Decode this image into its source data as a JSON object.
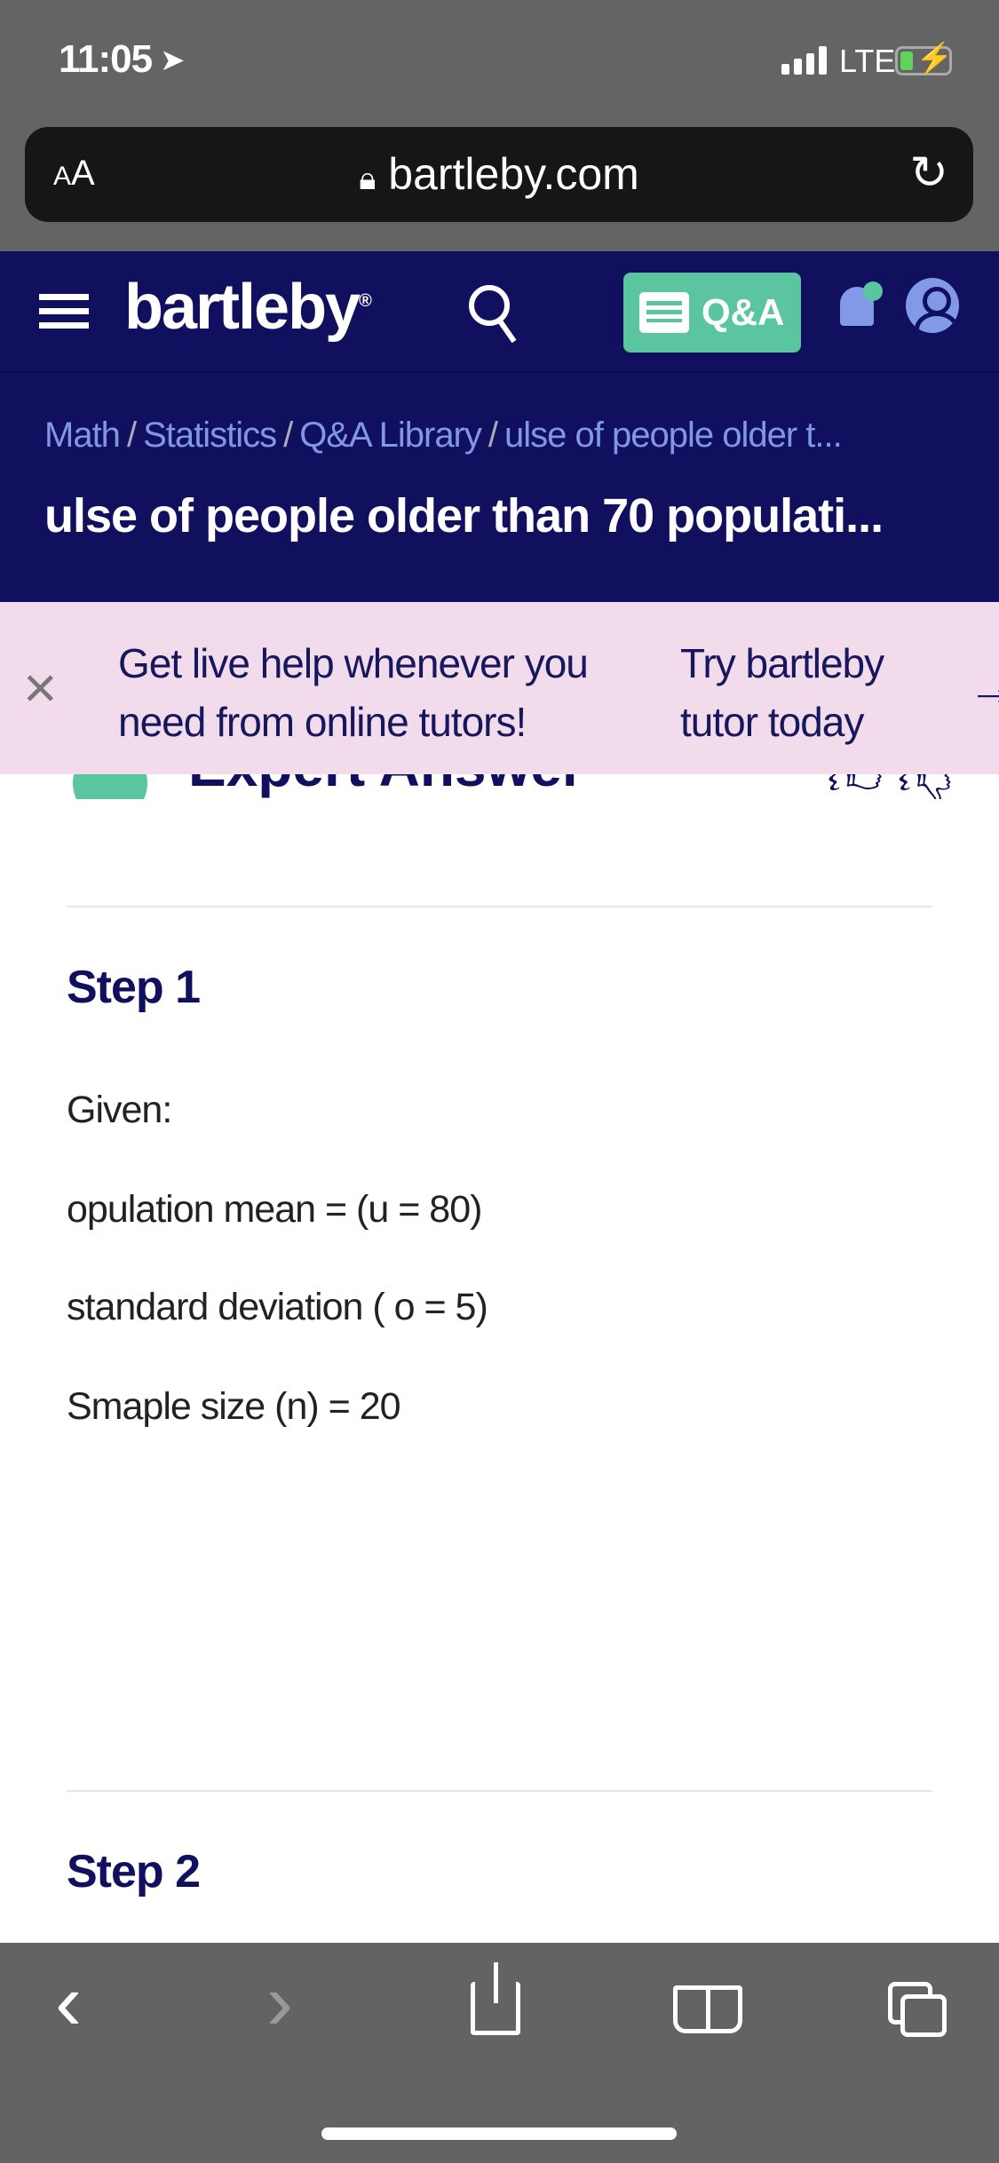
{
  "status_bar": {
    "time": "11:05",
    "location_icon": "location-arrow-icon",
    "network": "LTE",
    "battery_color": "#5fd35b"
  },
  "browser": {
    "text_size_label_small": "A",
    "text_size_label": "A",
    "url": "bartleby.com",
    "lock_icon": "lock-icon",
    "reload_icon": "reload-icon"
  },
  "nav": {
    "logo": "bartleby",
    "logo_mark": "®",
    "qa_label": "Q&A",
    "accent": "#5bc5a0",
    "brand": "#10105f"
  },
  "breadcrumb": [
    {
      "label": "Math"
    },
    {
      "label": "Statistics"
    },
    {
      "label": "Q&A Library"
    },
    {
      "label": "ulse of people older t..."
    }
  ],
  "breadcrumb_separator": "/",
  "page_title": "ulse of people older than 70 populati...",
  "banner": {
    "close": "×",
    "message": "Get live help whenever you need from online tutors!",
    "cta": "Try bartleby tutor today",
    "bg": "#f2dcec"
  },
  "answer": {
    "header": "Expert Answer",
    "steps": [
      {
        "title": "Step 1",
        "lines": [
          "Given:",
          "opulation mean = (u = 80)",
          "standard deviation ( o = 5)",
          "Smaple size (n) = 20"
        ]
      },
      {
        "title": "Step 2"
      }
    ]
  },
  "toolbar": {
    "back": "‹",
    "forward": "›"
  }
}
